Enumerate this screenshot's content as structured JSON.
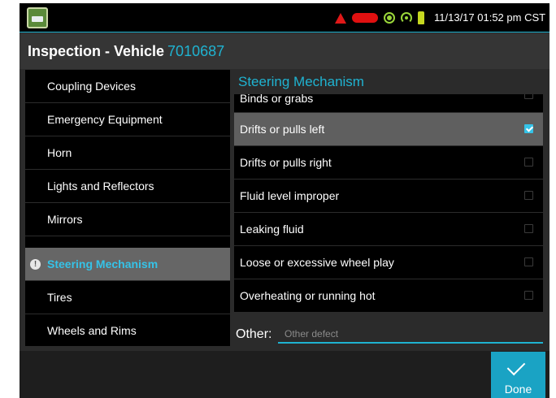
{
  "status_bar": {
    "clock": "11/13/17 01:52 pm CST",
    "icons": [
      "app-icon",
      "warning-icon",
      "gps-icon",
      "signal-icon",
      "plug-icon"
    ]
  },
  "header": {
    "title": "Inspection - Vehicle",
    "vehicle_id": "7010687"
  },
  "sidebar": {
    "items": [
      {
        "label": "Coupling Devices",
        "active": false
      },
      {
        "label": "Emergency Equipment",
        "active": false
      },
      {
        "label": "Horn",
        "active": false
      },
      {
        "label": "Lights and Reflectors",
        "active": false
      },
      {
        "label": "Mirrors",
        "active": false
      },
      {
        "label": "Steering Mechanism",
        "active": true
      },
      {
        "label": "Tires",
        "active": false
      },
      {
        "label": "Wheels and Rims",
        "active": false
      }
    ]
  },
  "panel": {
    "title": "Steering Mechanism",
    "defects": [
      {
        "label": "Binds or grabs",
        "checked": false
      },
      {
        "label": "Drifts or pulls left",
        "checked": true
      },
      {
        "label": "Drifts or pulls right",
        "checked": false
      },
      {
        "label": "Fluid level improper",
        "checked": false
      },
      {
        "label": "Leaking fluid",
        "checked": false
      },
      {
        "label": "Loose or excessive wheel play",
        "checked": false
      },
      {
        "label": "Overheating or running hot",
        "checked": false
      }
    ],
    "other_label": "Other:",
    "other_placeholder": "Other defect",
    "other_value": ""
  },
  "footer": {
    "done_label": "Done"
  },
  "colors": {
    "accent": "#1fb3d1",
    "selected_row": "#5f5f5f",
    "done_button": "#1aa3c4"
  }
}
